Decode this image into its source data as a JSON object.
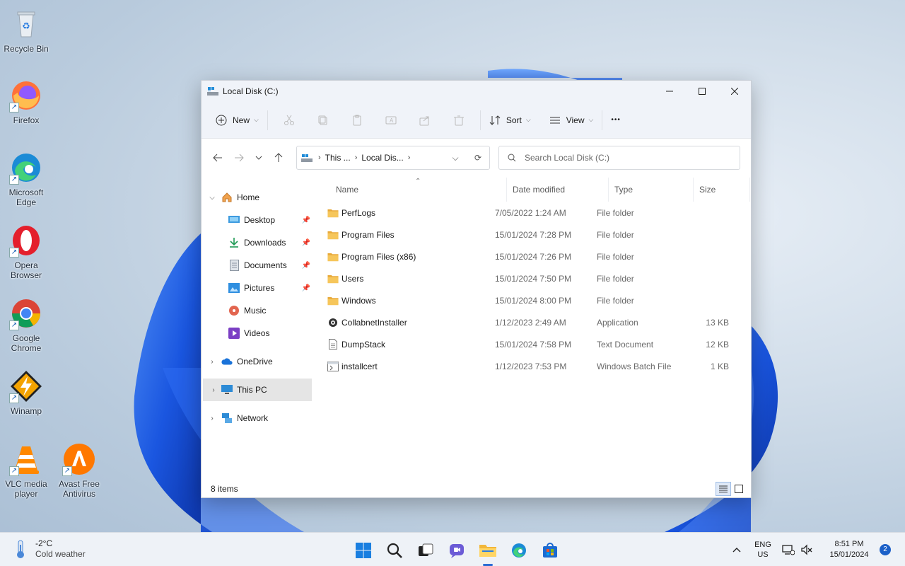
{
  "desktop": {
    "icons": [
      {
        "label": "Recycle Bin",
        "icon": "recycle-bin-icon"
      },
      {
        "label": "Firefox",
        "icon": "firefox-icon"
      },
      {
        "label": "Microsoft Edge",
        "icon": "edge-icon"
      },
      {
        "label": "Opera Browser",
        "icon": "opera-icon"
      },
      {
        "label": "Google Chrome",
        "icon": "chrome-icon"
      },
      {
        "label": "Winamp",
        "icon": "winamp-icon"
      },
      {
        "label": "VLC media player",
        "icon": "vlc-icon"
      },
      {
        "label": "Avast Free Antivirus",
        "icon": "avast-icon"
      }
    ]
  },
  "window": {
    "title": "Local Disk (C:)",
    "toolbar": {
      "new_label": "New",
      "sort_label": "Sort",
      "view_label": "View",
      "more_label": "•••"
    },
    "address": {
      "crumbs": [
        "This ...",
        "Local Dis..."
      ],
      "search_placeholder": "Search Local Disk (C:)"
    },
    "nav": {
      "home": "Home",
      "quick_access": [
        {
          "label": "Desktop",
          "pinned": true
        },
        {
          "label": "Downloads",
          "pinned": true
        },
        {
          "label": "Documents",
          "pinned": true
        },
        {
          "label": "Pictures",
          "pinned": true
        },
        {
          "label": "Music",
          "pinned": false
        },
        {
          "label": "Videos",
          "pinned": false
        }
      ],
      "onedrive": "OneDrive",
      "this_pc": "This PC",
      "network": "Network",
      "selected": "This PC"
    },
    "columns": {
      "name": "Name",
      "date": "Date modified",
      "type": "Type",
      "size": "Size"
    },
    "files": [
      {
        "name": "PerfLogs",
        "date": "7/05/2022 1:24 AM",
        "type": "File folder",
        "size": "",
        "icon": "folder-icon"
      },
      {
        "name": "Program Files",
        "date": "15/01/2024 7:28 PM",
        "type": "File folder",
        "size": "",
        "icon": "folder-icon"
      },
      {
        "name": "Program Files (x86)",
        "date": "15/01/2024 7:26 PM",
        "type": "File folder",
        "size": "",
        "icon": "folder-icon"
      },
      {
        "name": "Users",
        "date": "15/01/2024 7:50 PM",
        "type": "File folder",
        "size": "",
        "icon": "folder-icon"
      },
      {
        "name": "Windows",
        "date": "15/01/2024 8:00 PM",
        "type": "File folder",
        "size": "",
        "icon": "folder-icon"
      },
      {
        "name": "CollabnetInstaller",
        "date": "1/12/2023 2:49 AM",
        "type": "Application",
        "size": "13 KB",
        "icon": "application-icon"
      },
      {
        "name": "DumpStack",
        "date": "15/01/2024 7:58 PM",
        "type": "Text Document",
        "size": "12 KB",
        "icon": "text-document-icon"
      },
      {
        "name": "installcert",
        "date": "1/12/2023 7:53 PM",
        "type": "Windows Batch File",
        "size": "1 KB",
        "icon": "batch-file-icon"
      }
    ],
    "status": "8 items"
  },
  "taskbar": {
    "weather_temp": "-2°C",
    "weather_condition": "Cold weather",
    "lang_line1": "ENG",
    "lang_line2": "US",
    "time": "8:51 PM",
    "date": "15/01/2024",
    "notification_count": "2"
  },
  "colors": {
    "accent": "#2a6cd4",
    "folder": "#f2c14e",
    "selected_nav": "#e5e5e5"
  }
}
